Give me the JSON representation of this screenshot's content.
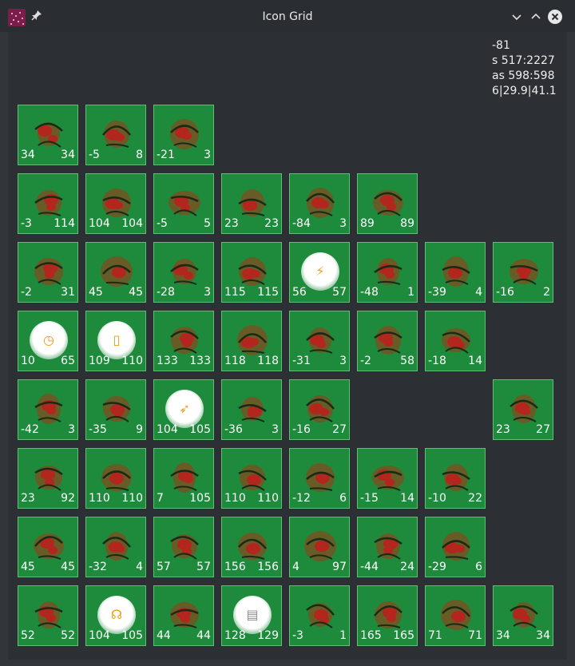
{
  "window": {
    "title": "Icon Grid",
    "buttons": {
      "minimize": "⌵",
      "maximize": "⌃",
      "close": "✕"
    }
  },
  "info_lines": [
    "-81",
    "s 517:2227",
    "as 598:598",
    "6|29.9|41.1"
  ],
  "colors": {
    "tile": "#1e8a3c",
    "tile_border": "#5fbd74",
    "glyph_red": "#b3261e",
    "glyph_olive": "#6b5a25",
    "glyph_dark": "#1b2a15"
  },
  "rows": [
    [
      {
        "icon": "paw-icon",
        "a": "34",
        "b": "34"
      },
      {
        "icon": "butterfly-icon",
        "a": "-5",
        "b": "8"
      },
      {
        "icon": "treble-clef-icon",
        "a": "-21",
        "b": "3"
      }
    ],
    [
      {
        "icon": "hand-icon",
        "a": "-3",
        "b": "114"
      },
      {
        "icon": "ball-icon",
        "a": "104",
        "b": "104"
      },
      {
        "icon": "binoculars-icon",
        "a": "-5",
        "b": "5"
      },
      {
        "icon": "camera-icon",
        "a": "23",
        "b": "23"
      },
      {
        "icon": "info-icon",
        "a": "-84",
        "b": "3"
      },
      {
        "icon": "ladder-icon",
        "a": "89",
        "b": "89"
      }
    ],
    [
      {
        "icon": "ship-icon",
        "a": "-2",
        "b": "31"
      },
      {
        "icon": "anchor-icon",
        "a": "45",
        "b": "45"
      },
      {
        "icon": "train-icon",
        "a": "-28",
        "b": "3"
      },
      {
        "icon": "fishbowl-icon",
        "a": "115",
        "b": "115"
      },
      {
        "icon": "plug-icon",
        "a": "56",
        "b": "57",
        "bubble": true,
        "symbol": "⚡",
        "symcolor": "#f0a020"
      },
      {
        "icon": "baby-face-icon",
        "a": "-48",
        "b": "1"
      },
      {
        "icon": "eye-icon",
        "a": "-39",
        "b": "4"
      },
      {
        "icon": "heart-lock-icon",
        "a": "-16",
        "b": "2"
      }
    ],
    [
      {
        "icon": "clock-icon",
        "a": "10",
        "b": "65",
        "bubble": true,
        "symbol": "◷",
        "symcolor": "#f09a10"
      },
      {
        "icon": "phone-icon",
        "a": "109",
        "b": "110",
        "bubble": true,
        "symbol": "▯",
        "symcolor": "#f09a10"
      },
      {
        "icon": "tools-icon",
        "a": "133",
        "b": "133"
      },
      {
        "icon": "microscope-icon",
        "a": "118",
        "b": "118"
      },
      {
        "icon": "drop-icon",
        "a": "-31",
        "b": "3"
      },
      {
        "icon": "gauge-icon",
        "a": "-2",
        "b": "58"
      },
      {
        "icon": "pliers-icon",
        "a": "-18",
        "b": "14"
      }
    ],
    [
      {
        "icon": "trumpet-icon",
        "a": "-42",
        "b": "3"
      },
      {
        "icon": "tuba-icon",
        "a": "-35",
        "b": "9"
      },
      {
        "icon": "bow-arrow-icon",
        "a": "104",
        "b": "105",
        "bubble": true,
        "symbol": "➶",
        "symcolor": "#e0a020"
      },
      {
        "icon": "superman-icon",
        "a": "-36",
        "b": "3"
      },
      {
        "icon": "arrows-icon",
        "a": "-16",
        "b": "27"
      },
      null,
      null,
      {
        "icon": "clipboard-icon",
        "a": "23",
        "b": "27"
      }
    ],
    [
      {
        "icon": "snowflake-icon",
        "a": "23",
        "b": "92"
      },
      {
        "icon": "duck-icon",
        "a": "110",
        "b": "110"
      },
      {
        "icon": "kangaroo-icon",
        "a": "7",
        "b": "105"
      },
      {
        "icon": "chain-icon",
        "a": "110",
        "b": "110"
      },
      {
        "icon": "bicycle-icon",
        "a": "-12",
        "b": "6"
      },
      {
        "icon": "robot-icon",
        "a": "-15",
        "b": "14"
      },
      {
        "icon": "shaking-hands-icon",
        "a": "-10",
        "b": "22"
      }
    ],
    [
      {
        "icon": "keyboard-icon",
        "a": "45",
        "b": "45"
      },
      {
        "icon": "map-icon",
        "a": "-32",
        "b": "4"
      },
      {
        "icon": "paperclips-icon",
        "a": "57",
        "b": "57"
      },
      {
        "icon": "broadcast-icon",
        "a": "156",
        "b": "156"
      },
      {
        "icon": "syringe-icon",
        "a": "4",
        "b": "97"
      },
      {
        "icon": "pen-icon",
        "a": "-44",
        "b": "24"
      },
      {
        "icon": "restroom-icon",
        "a": "-29",
        "b": "6"
      }
    ],
    [
      {
        "icon": "registered-icon",
        "a": "52",
        "b": "52"
      },
      {
        "icon": "headphones-icon",
        "a": "104",
        "b": "105",
        "bubble": true,
        "symbol": "☊",
        "symcolor": "#f09a10"
      },
      {
        "icon": "monitor-icon",
        "a": "44",
        "b": "44"
      },
      {
        "icon": "document-icon",
        "a": "128",
        "b": "129",
        "bubble": true,
        "symbol": "▤",
        "symcolor": "#888888"
      },
      {
        "icon": "chart-icon",
        "a": "-3",
        "b": "1"
      },
      {
        "icon": "globe-icon",
        "a": "165",
        "b": "165"
      },
      {
        "icon": "music-note-icon",
        "a": "71",
        "b": "71"
      },
      {
        "icon": "floppy-disk-icon",
        "a": "34",
        "b": "34"
      }
    ]
  ]
}
